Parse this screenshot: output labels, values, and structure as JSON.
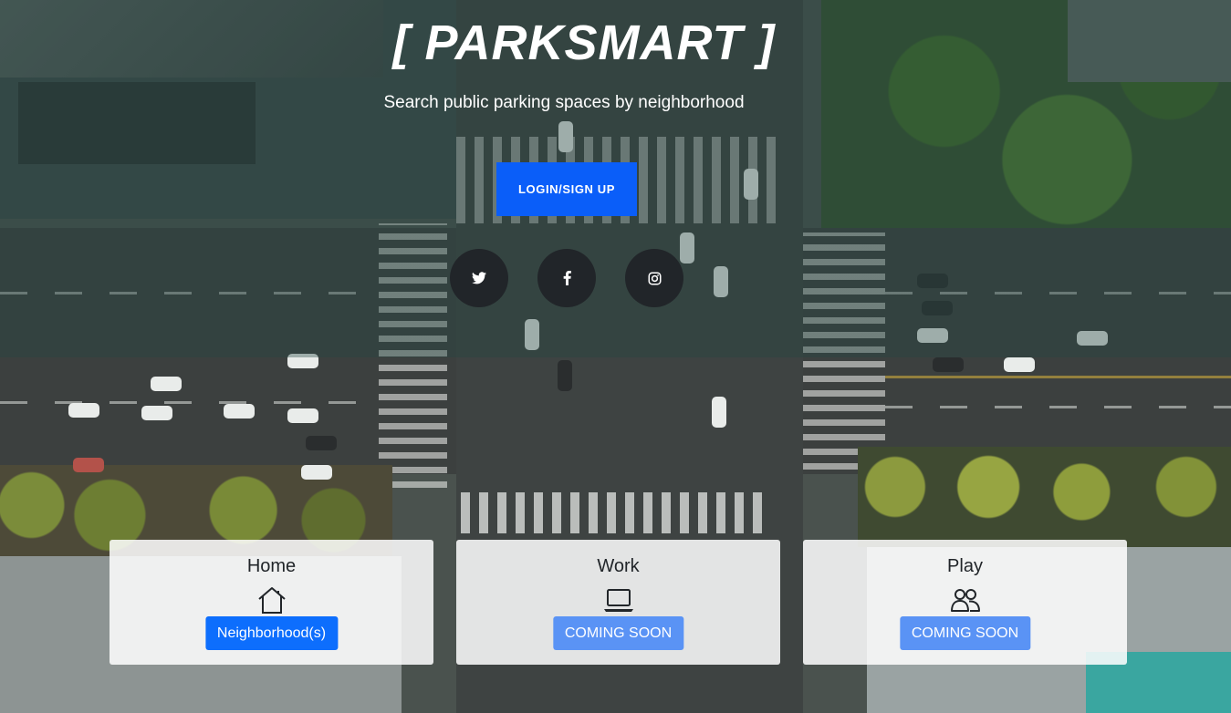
{
  "hero": {
    "title": "[ PARKSMART ]",
    "subtitle": "Search public parking spaces by neighborhood",
    "login_label": "LOGIN/SIGN UP"
  },
  "social": [
    {
      "name": "twitter-icon"
    },
    {
      "name": "facebook-icon"
    },
    {
      "name": "instagram-icon"
    }
  ],
  "cards": [
    {
      "title": "Home",
      "icon": "house-icon",
      "button": "Neighborhood(s)",
      "state": "active"
    },
    {
      "title": "Work",
      "icon": "laptop-icon",
      "button": "COMING SOON",
      "state": "disabled"
    },
    {
      "title": "Play",
      "icon": "people-icon",
      "button": "COMING SOON",
      "state": "disabled"
    }
  ],
  "colors": {
    "primary": "#0d6efd",
    "login": "#0a5ef9",
    "social_bg": "#212529",
    "disabled_button": "#5a93f5"
  }
}
